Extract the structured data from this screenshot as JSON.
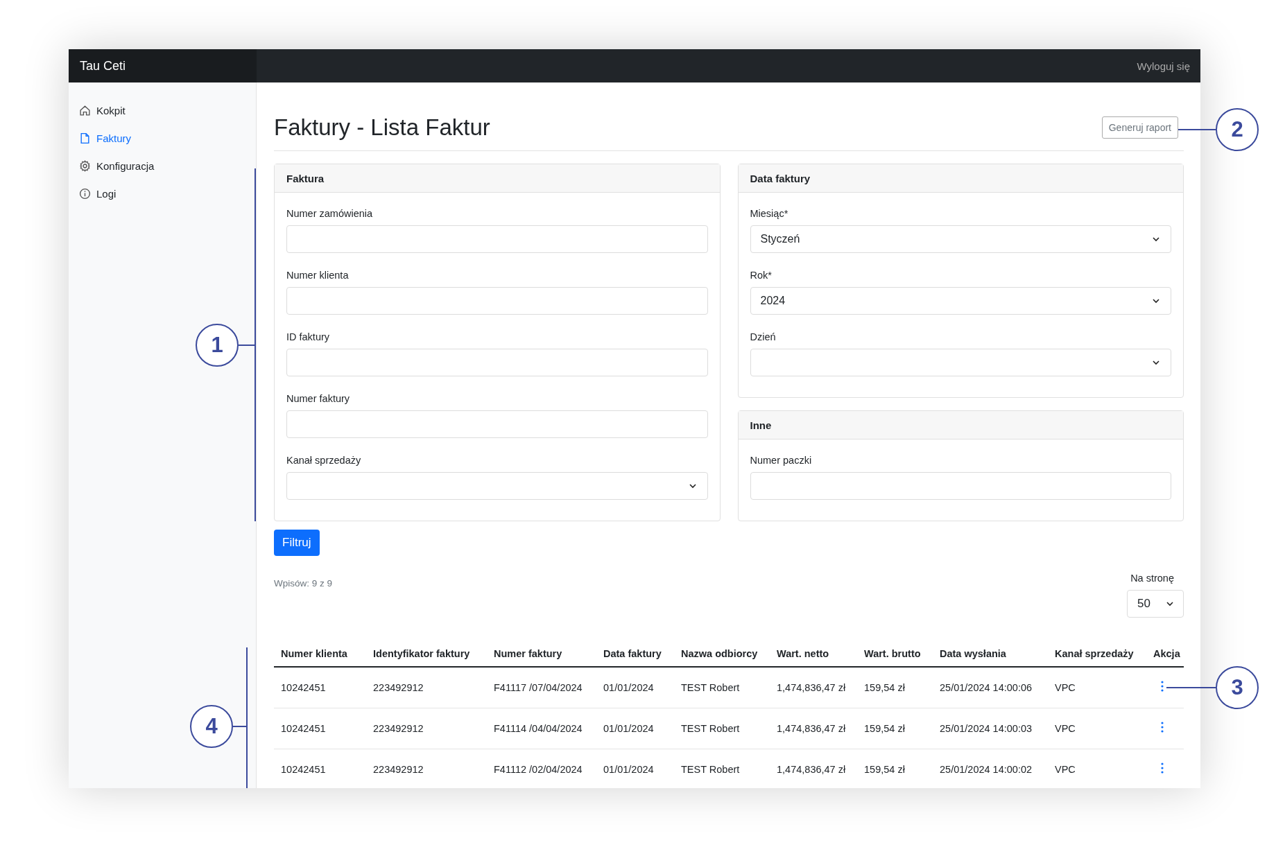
{
  "app": {
    "brand": "Tau Ceti",
    "logout": "Wyloguj się"
  },
  "sidebar": {
    "items": [
      {
        "label": "Kokpit",
        "selected": false
      },
      {
        "label": "Faktury",
        "selected": true
      },
      {
        "label": "Konfiguracja",
        "selected": false
      },
      {
        "label": "Logi",
        "selected": false
      }
    ]
  },
  "page": {
    "title": "Faktury - Lista Faktur",
    "report_button": "Generuj raport"
  },
  "filters": [
    {
      "title": "Faktura",
      "fields": [
        {
          "label": "Numer zamówienia",
          "kind": "text"
        },
        {
          "label": "Numer klienta",
          "kind": "text"
        },
        {
          "label": "ID faktury",
          "kind": "text"
        },
        {
          "label": "Numer faktury",
          "kind": "text"
        },
        {
          "label": "Kanał sprzedaży",
          "kind": "select"
        }
      ]
    },
    {
      "title": "Data faktury",
      "fields": [
        {
          "label": "Miesiąc*",
          "kind": "select",
          "value": "Styczeń"
        },
        {
          "label": "Rok*",
          "kind": "select",
          "value": "2024"
        },
        {
          "label": "Dzień",
          "kind": "select"
        }
      ]
    },
    {
      "title": "Inne",
      "fields": [
        {
          "label": "Numer paczki",
          "kind": "text"
        }
      ]
    }
  ],
  "filter_button": "Filtruj",
  "count": "Wpisów: 9 z 9",
  "per_page": {
    "label": "Na stronę",
    "value": "50"
  },
  "table": {
    "columns": [
      "Numer klienta",
      "Identyfikator faktury",
      "Numer faktury",
      "Data faktury",
      "Nazwa odbiorcy",
      "Wart. netto",
      "Wart. brutto",
      "Data wysłania",
      "Kanał sprzedaży",
      "Akcja"
    ],
    "rows": [
      [
        "10242451",
        "223492912",
        "F41117 /07/04/2024",
        "01/01/2024",
        "TEST Robert",
        "1,474,836,47 zł",
        "159,54 zł",
        "25/01/2024 14:00:06",
        "VPC"
      ],
      [
        "10242451",
        "223492912",
        "F41114 /04/04/2024",
        "01/01/2024",
        "TEST Robert",
        "1,474,836,47 zł",
        "159,54 zł",
        "25/01/2024 14:00:03",
        "VPC"
      ],
      [
        "10242451",
        "223492912",
        "F41112 /02/04/2024",
        "01/01/2024",
        "TEST Robert",
        "1,474,836,47 zł",
        "159,54 zł",
        "25/01/2024 14:00:02",
        "VPC"
      ]
    ]
  },
  "callouts": [
    {
      "label": "1"
    },
    {
      "label": "2"
    },
    {
      "label": "3"
    },
    {
      "label": "4"
    }
  ]
}
